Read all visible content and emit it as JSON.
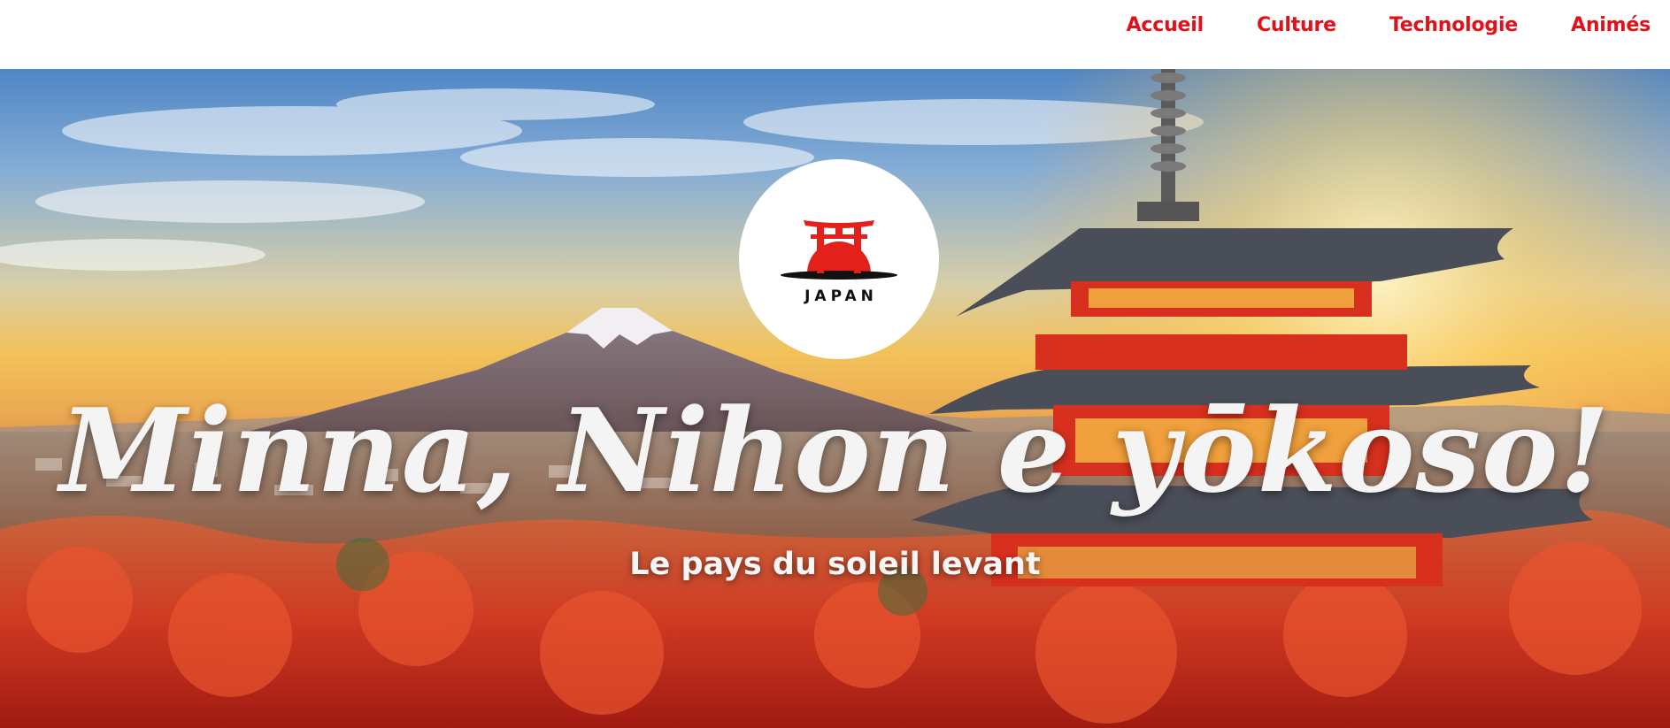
{
  "nav": {
    "items": [
      {
        "label": "Accueil"
      },
      {
        "label": "Culture"
      },
      {
        "label": "Technologie"
      },
      {
        "label": "Animés"
      }
    ],
    "color": "#e3101a"
  },
  "logo": {
    "text": "JAPAN",
    "icon": "torii-gate-sun-icon"
  },
  "hero": {
    "title": "Minna, Nihon e yōkoso!",
    "subtitle": "Le pays du soleil levant",
    "image": "mount-fuji-pagoda-landscape"
  }
}
